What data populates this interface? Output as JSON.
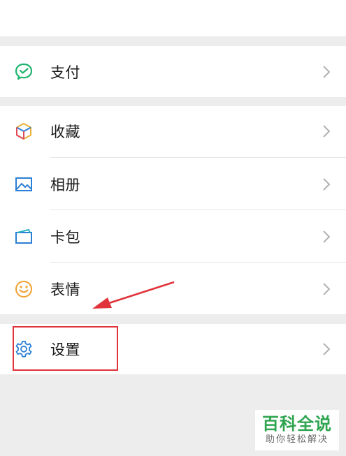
{
  "menu": {
    "pay": {
      "label": "支付",
      "icon": "wechat-pay-icon"
    },
    "favorites": {
      "label": "收藏",
      "icon": "cube-favorites-icon"
    },
    "album": {
      "label": "相册",
      "icon": "photo-album-icon"
    },
    "cards": {
      "label": "卡包",
      "icon": "card-wallet-icon"
    },
    "stickers": {
      "label": "表情",
      "icon": "smiley-face-icon"
    },
    "settings": {
      "label": "设置",
      "icon": "gear-icon"
    }
  },
  "annotation": {
    "highlight_color": "#e0333a"
  },
  "watermark": {
    "title": "百科全说",
    "subtitle": "助你轻松解决"
  },
  "colors": {
    "background": "#ededed",
    "pay_green": "#1fb46e",
    "icon_blue": "#2b7fd4",
    "smiley_orange": "#f0a030"
  }
}
